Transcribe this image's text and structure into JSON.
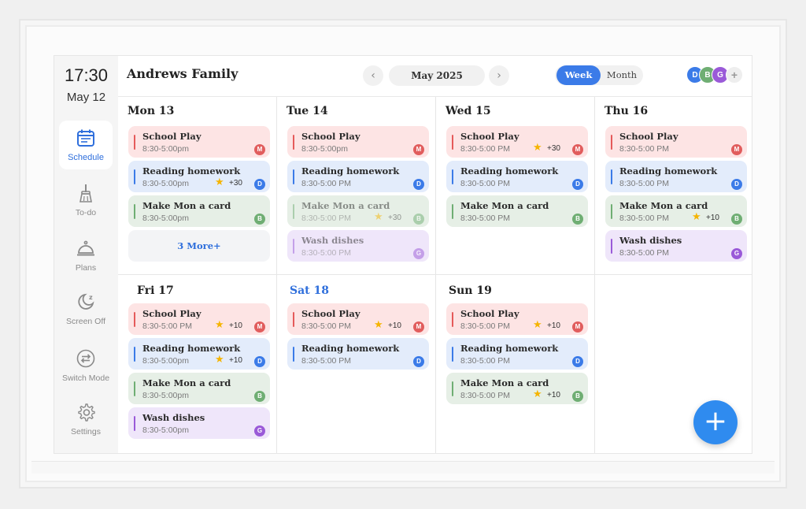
{
  "sidebar": {
    "time": "17:30",
    "date": "May 12",
    "items": [
      {
        "label": "Schedule",
        "icon": "calendar-icon"
      },
      {
        "label": "To-do",
        "icon": "broom-icon"
      },
      {
        "label": "Plans",
        "icon": "cloche-icon"
      },
      {
        "label": "Screen Off",
        "icon": "moon-icon"
      },
      {
        "label": "Switch Mode",
        "icon": "swap-icon"
      },
      {
        "label": "Settings",
        "icon": "gear-icon"
      }
    ]
  },
  "header": {
    "family_name": "Andrews Family",
    "month": "May 2025",
    "prev": "‹",
    "next": "›",
    "view_week": "Week",
    "view_month": "Month",
    "avatars": [
      "D",
      "B",
      "G"
    ],
    "add_member": "+"
  },
  "colors": {
    "accent": "#3b7be8",
    "red": "#fde4e4",
    "blue": "#e3ecfb",
    "green": "#e6efe6",
    "purple": "#efe6fa"
  },
  "days": [
    {
      "title": "Mon 13",
      "weekend": false,
      "more": "3 More+",
      "events": [
        {
          "title": "School Play",
          "time": "8:30-5:00pm",
          "color": "red",
          "badge": "M",
          "points": ""
        },
        {
          "title": "Reading homework",
          "time": "8:30-5:00pm",
          "color": "blue",
          "badge": "D",
          "points": "+30"
        },
        {
          "title": "Make Mon a card",
          "time": "8:30-5:00pm",
          "color": "green",
          "badge": "B",
          "points": ""
        }
      ]
    },
    {
      "title": "Tue 14",
      "weekend": false,
      "events": [
        {
          "title": "School Play",
          "time": "8:30-5:00pm",
          "color": "red",
          "badge": "M",
          "points": ""
        },
        {
          "title": "Reading homework",
          "time": "8:30-5:00 PM",
          "color": "blue",
          "badge": "D",
          "points": ""
        },
        {
          "title": "Make Mon a card",
          "time": "8:30-5:00 PM",
          "color": "green",
          "badge": "B",
          "points": "+30",
          "faded": true
        },
        {
          "title": "Wash dishes",
          "time": "8:30-5:00 PM",
          "color": "purple",
          "badge": "G",
          "points": "",
          "faded": true
        }
      ]
    },
    {
      "title": "Wed 15",
      "weekend": false,
      "events": [
        {
          "title": "School Play",
          "time": "8:30-5:00 PM",
          "color": "red",
          "badge": "M",
          "points": "+30"
        },
        {
          "title": "Reading homework",
          "time": "8:30-5:00 PM",
          "color": "blue",
          "badge": "D",
          "points": ""
        },
        {
          "title": "Make Mon a card",
          "time": "8:30-5:00 PM",
          "color": "green",
          "badge": "B",
          "points": ""
        }
      ]
    },
    {
      "title": "Thu 16",
      "weekend": false,
      "events": [
        {
          "title": "School Play",
          "time": "8:30-5:00 PM",
          "color": "red",
          "badge": "M",
          "points": ""
        },
        {
          "title": "Reading homework",
          "time": "8:30-5:00 PM",
          "color": "blue",
          "badge": "D",
          "points": ""
        },
        {
          "title": "Make Mon a card",
          "time": "8:30-5:00 PM",
          "color": "green",
          "badge": "B",
          "points": "+10"
        },
        {
          "title": "Wash dishes",
          "time": "8:30-5:00 PM",
          "color": "purple",
          "badge": "G",
          "points": ""
        }
      ]
    },
    {
      "title": "Fri 17",
      "weekend": false,
      "events": [
        {
          "title": "School Play",
          "time": "8:30-5:00 PM",
          "color": "red",
          "badge": "M",
          "points": "+10"
        },
        {
          "title": "Reading homework",
          "time": "8:30-5:00pm",
          "color": "blue",
          "badge": "D",
          "points": "+10"
        },
        {
          "title": "Make Mon a card",
          "time": "8:30-5:00pm",
          "color": "green",
          "badge": "B",
          "points": ""
        },
        {
          "title": "Wash dishes",
          "time": "8:30-5:00pm",
          "color": "purple",
          "badge": "G",
          "points": ""
        }
      ]
    },
    {
      "title": "Sat 18",
      "weekend": true,
      "events": [
        {
          "title": "School Play",
          "time": "8:30-5:00 PM",
          "color": "red",
          "badge": "M",
          "points": "+10"
        },
        {
          "title": "Reading homework",
          "time": "8:30-5:00 PM",
          "color": "blue",
          "badge": "D",
          "points": ""
        }
      ]
    },
    {
      "title": "Sun 19",
      "weekend": false,
      "events": [
        {
          "title": "School Play",
          "time": "8:30-5:00 PM",
          "color": "red",
          "badge": "M",
          "points": "+10"
        },
        {
          "title": "Reading homework",
          "time": "8:30-5:00 PM",
          "color": "blue",
          "badge": "D",
          "points": ""
        },
        {
          "title": "Make Mon a card",
          "time": "8:30-5:00 PM",
          "color": "green",
          "badge": "B",
          "points": "+10"
        }
      ]
    }
  ],
  "fab": "+"
}
